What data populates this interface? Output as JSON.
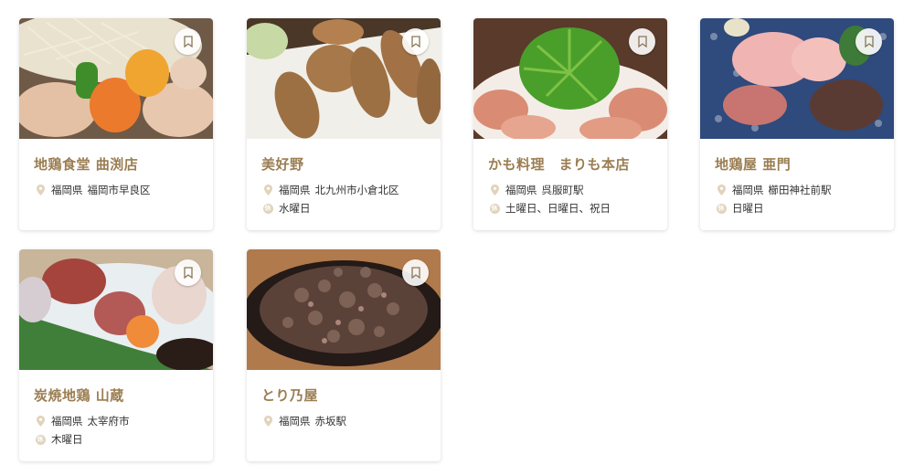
{
  "colors": {
    "title": "#9b7d52",
    "icon": "#e1d3bc"
  },
  "icons": {
    "bookmark": "bookmark-icon",
    "location": "location-pin-icon",
    "holiday": "holiday-icon"
  },
  "holiday_icon_glyph": "休",
  "cards": [
    {
      "name": "地鶏食堂 曲渕店",
      "prefecture": "福岡県",
      "area": "福岡市早良区",
      "holiday": ""
    },
    {
      "name": "美好野",
      "prefecture": "福岡県",
      "area": "北九州市小倉北区",
      "holiday": "水曜日"
    },
    {
      "name": "かも料理　まりも本店",
      "prefecture": "福岡県",
      "area": "呉服町駅",
      "holiday": "土曜日、日曜日、祝日"
    },
    {
      "name": "地鶏屋 亜門",
      "prefecture": "福岡県",
      "area": "櫛田神社前駅",
      "holiday": "日曜日"
    },
    {
      "name": "炭焼地鶏 山蔵",
      "prefecture": "福岡県",
      "area": "太宰府市",
      "holiday": "木曜日"
    },
    {
      "name": "とり乃屋",
      "prefecture": "福岡県",
      "area": "赤坂駅",
      "holiday": ""
    }
  ]
}
